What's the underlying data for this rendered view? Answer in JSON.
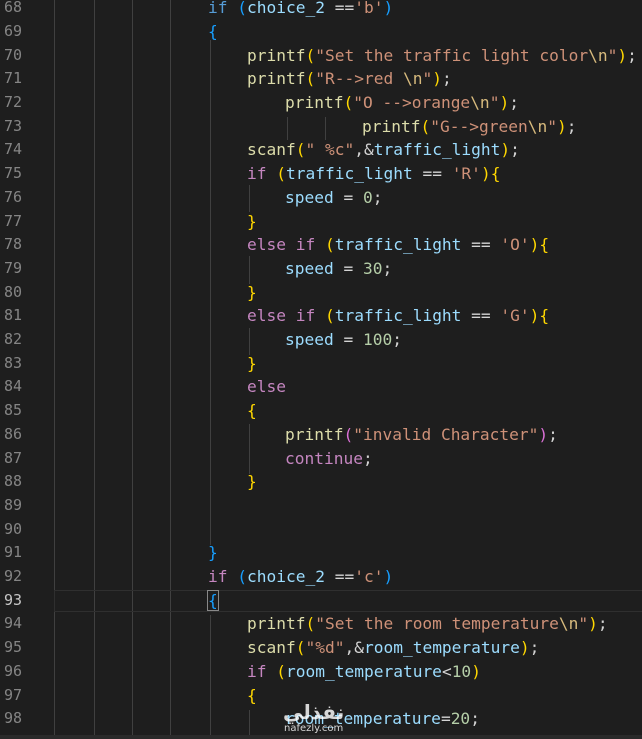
{
  "editor": {
    "lines": [
      {
        "num": "68",
        "tokens": [
          [
            "k",
            "if"
          ],
          [
            "p",
            " "
          ],
          [
            "b3",
            "("
          ],
          [
            "v",
            "choice_2"
          ],
          [
            "p",
            " =="
          ],
          [
            "s",
            "'b'"
          ],
          [
            "b3",
            ")"
          ]
        ]
      },
      {
        "num": "69",
        "tokens": [
          [
            "b3",
            "{"
          ]
        ]
      },
      {
        "num": "70",
        "tokens": [
          [
            "f",
            "printf"
          ],
          [
            "b1",
            "("
          ],
          [
            "s",
            "\"Set the traffic light color"
          ],
          [
            "e",
            "\\n"
          ],
          [
            "s",
            "\""
          ],
          [
            "b1",
            ")"
          ],
          [
            "p",
            ";"
          ]
        ]
      },
      {
        "num": "71",
        "tokens": [
          [
            "f",
            "printf"
          ],
          [
            "b1",
            "("
          ],
          [
            "s",
            "\"R-->red "
          ],
          [
            "e",
            "\\n"
          ],
          [
            "s",
            "\""
          ],
          [
            "b1",
            ")"
          ],
          [
            "p",
            ";"
          ]
        ]
      },
      {
        "num": "72",
        "tokens": [
          [
            "f",
            "printf"
          ],
          [
            "b1",
            "("
          ],
          [
            "s",
            "\"O -->orange"
          ],
          [
            "e",
            "\\n"
          ],
          [
            "s",
            "\""
          ],
          [
            "b1",
            ")"
          ],
          [
            "p",
            ";"
          ]
        ]
      },
      {
        "num": "73",
        "tokens": [
          [
            "f",
            "printf"
          ],
          [
            "b1",
            "("
          ],
          [
            "s",
            "\"G-->green"
          ],
          [
            "e",
            "\\n"
          ],
          [
            "s",
            "\""
          ],
          [
            "b1",
            ")"
          ],
          [
            "p",
            ";"
          ]
        ]
      },
      {
        "num": "74",
        "tokens": [
          [
            "f",
            "scanf"
          ],
          [
            "b1",
            "("
          ],
          [
            "s",
            "\" %c\""
          ],
          [
            "p",
            ",&"
          ],
          [
            "v",
            "traffic_light"
          ],
          [
            "b1",
            ")"
          ],
          [
            "p",
            ";"
          ]
        ]
      },
      {
        "num": "75",
        "tokens": [
          [
            "c",
            "if"
          ],
          [
            "p",
            " "
          ],
          [
            "b1",
            "("
          ],
          [
            "v",
            "traffic_light"
          ],
          [
            "p",
            " == "
          ],
          [
            "s",
            "'R'"
          ],
          [
            "b1",
            ")"
          ],
          [
            "b1",
            "{"
          ]
        ]
      },
      {
        "num": "76",
        "tokens": [
          [
            "v",
            "speed"
          ],
          [
            "p",
            " = "
          ],
          [
            "n",
            "0"
          ],
          [
            "p",
            ";"
          ]
        ]
      },
      {
        "num": "77",
        "tokens": [
          [
            "b1",
            "}"
          ]
        ]
      },
      {
        "num": "78",
        "tokens": [
          [
            "c",
            "else"
          ],
          [
            "p",
            " "
          ],
          [
            "c",
            "if"
          ],
          [
            "p",
            " "
          ],
          [
            "b1",
            "("
          ],
          [
            "v",
            "traffic_light"
          ],
          [
            "p",
            " == "
          ],
          [
            "s",
            "'O'"
          ],
          [
            "b1",
            ")"
          ],
          [
            "b1",
            "{"
          ]
        ]
      },
      {
        "num": "79",
        "tokens": [
          [
            "v",
            "speed"
          ],
          [
            "p",
            " = "
          ],
          [
            "n",
            "30"
          ],
          [
            "p",
            ";"
          ]
        ]
      },
      {
        "num": "80",
        "tokens": [
          [
            "b1",
            "}"
          ]
        ]
      },
      {
        "num": "81",
        "tokens": [
          [
            "c",
            "else"
          ],
          [
            "p",
            " "
          ],
          [
            "c",
            "if"
          ],
          [
            "p",
            " "
          ],
          [
            "b1",
            "("
          ],
          [
            "v",
            "traffic_light"
          ],
          [
            "p",
            " == "
          ],
          [
            "s",
            "'G'"
          ],
          [
            "b1",
            ")"
          ],
          [
            "b1",
            "{"
          ]
        ]
      },
      {
        "num": "82",
        "tokens": [
          [
            "v",
            "speed"
          ],
          [
            "p",
            " = "
          ],
          [
            "n",
            "100"
          ],
          [
            "p",
            ";"
          ]
        ]
      },
      {
        "num": "83",
        "tokens": [
          [
            "b1",
            "}"
          ]
        ]
      },
      {
        "num": "84",
        "tokens": [
          [
            "c",
            "else"
          ]
        ]
      },
      {
        "num": "85",
        "tokens": [
          [
            "b1",
            "{"
          ]
        ]
      },
      {
        "num": "86",
        "tokens": [
          [
            "f",
            "printf"
          ],
          [
            "b2",
            "("
          ],
          [
            "s",
            "\"invalid Character\""
          ],
          [
            "b2",
            ")"
          ],
          [
            "p",
            ";"
          ]
        ]
      },
      {
        "num": "87",
        "tokens": [
          [
            "c",
            "continue"
          ],
          [
            "p",
            ";"
          ]
        ]
      },
      {
        "num": "88",
        "tokens": [
          [
            "b1",
            "}"
          ]
        ]
      },
      {
        "num": "89",
        "tokens": []
      },
      {
        "num": "90",
        "tokens": []
      },
      {
        "num": "91",
        "tokens": [
          [
            "b3",
            "}"
          ]
        ]
      },
      {
        "num": "92",
        "tokens": [
          [
            "c",
            "if"
          ],
          [
            "p",
            " "
          ],
          [
            "b3",
            "("
          ],
          [
            "v",
            "choice_2"
          ],
          [
            "p",
            " =="
          ],
          [
            "s",
            "'c'"
          ],
          [
            "b3",
            ")"
          ]
        ]
      },
      {
        "num": "93",
        "tokens": [
          [
            "b3",
            "{"
          ]
        ]
      },
      {
        "num": "94",
        "tokens": [
          [
            "f",
            "printf"
          ],
          [
            "b1",
            "("
          ],
          [
            "s",
            "\"Set the room temperature"
          ],
          [
            "e",
            "\\n"
          ],
          [
            "s",
            "\""
          ],
          [
            "b1",
            ")"
          ],
          [
            "p",
            ";"
          ]
        ]
      },
      {
        "num": "95",
        "tokens": [
          [
            "f",
            "scanf"
          ],
          [
            "b1",
            "("
          ],
          [
            "s",
            "\"%d\""
          ],
          [
            "p",
            ",&"
          ],
          [
            "v",
            "room_temperature"
          ],
          [
            "b1",
            ")"
          ],
          [
            "p",
            ";"
          ]
        ]
      },
      {
        "num": "96",
        "tokens": [
          [
            "c",
            "if"
          ],
          [
            "p",
            " "
          ],
          [
            "b1",
            "("
          ],
          [
            "v",
            "room_temperature"
          ],
          [
            "p",
            "<"
          ],
          [
            "n",
            "10"
          ],
          [
            "b1",
            ")"
          ]
        ]
      },
      {
        "num": "97",
        "tokens": [
          [
            "b1",
            "{"
          ]
        ]
      },
      {
        "num": "98",
        "tokens": [
          [
            "v",
            "room_temperature"
          ],
          [
            "p",
            "="
          ],
          [
            "n",
            "20"
          ],
          [
            "p",
            ";"
          ]
        ]
      }
    ],
    "active_line": "93"
  },
  "watermark": {
    "arabic": "نفذلي",
    "url": "nafezly.com"
  },
  "colors": {
    "background": "#1e1e1e",
    "keyword": "#569cd6",
    "control": "#c586c0",
    "function": "#dcdcaa",
    "string": "#ce9178",
    "escape": "#d7ba7d",
    "variable": "#9cdcfe",
    "number": "#b5cea8",
    "bracket_gold": "#ffd700",
    "bracket_orchid": "#da70d6",
    "bracket_blue": "#179fff",
    "line_number": "#858585"
  }
}
